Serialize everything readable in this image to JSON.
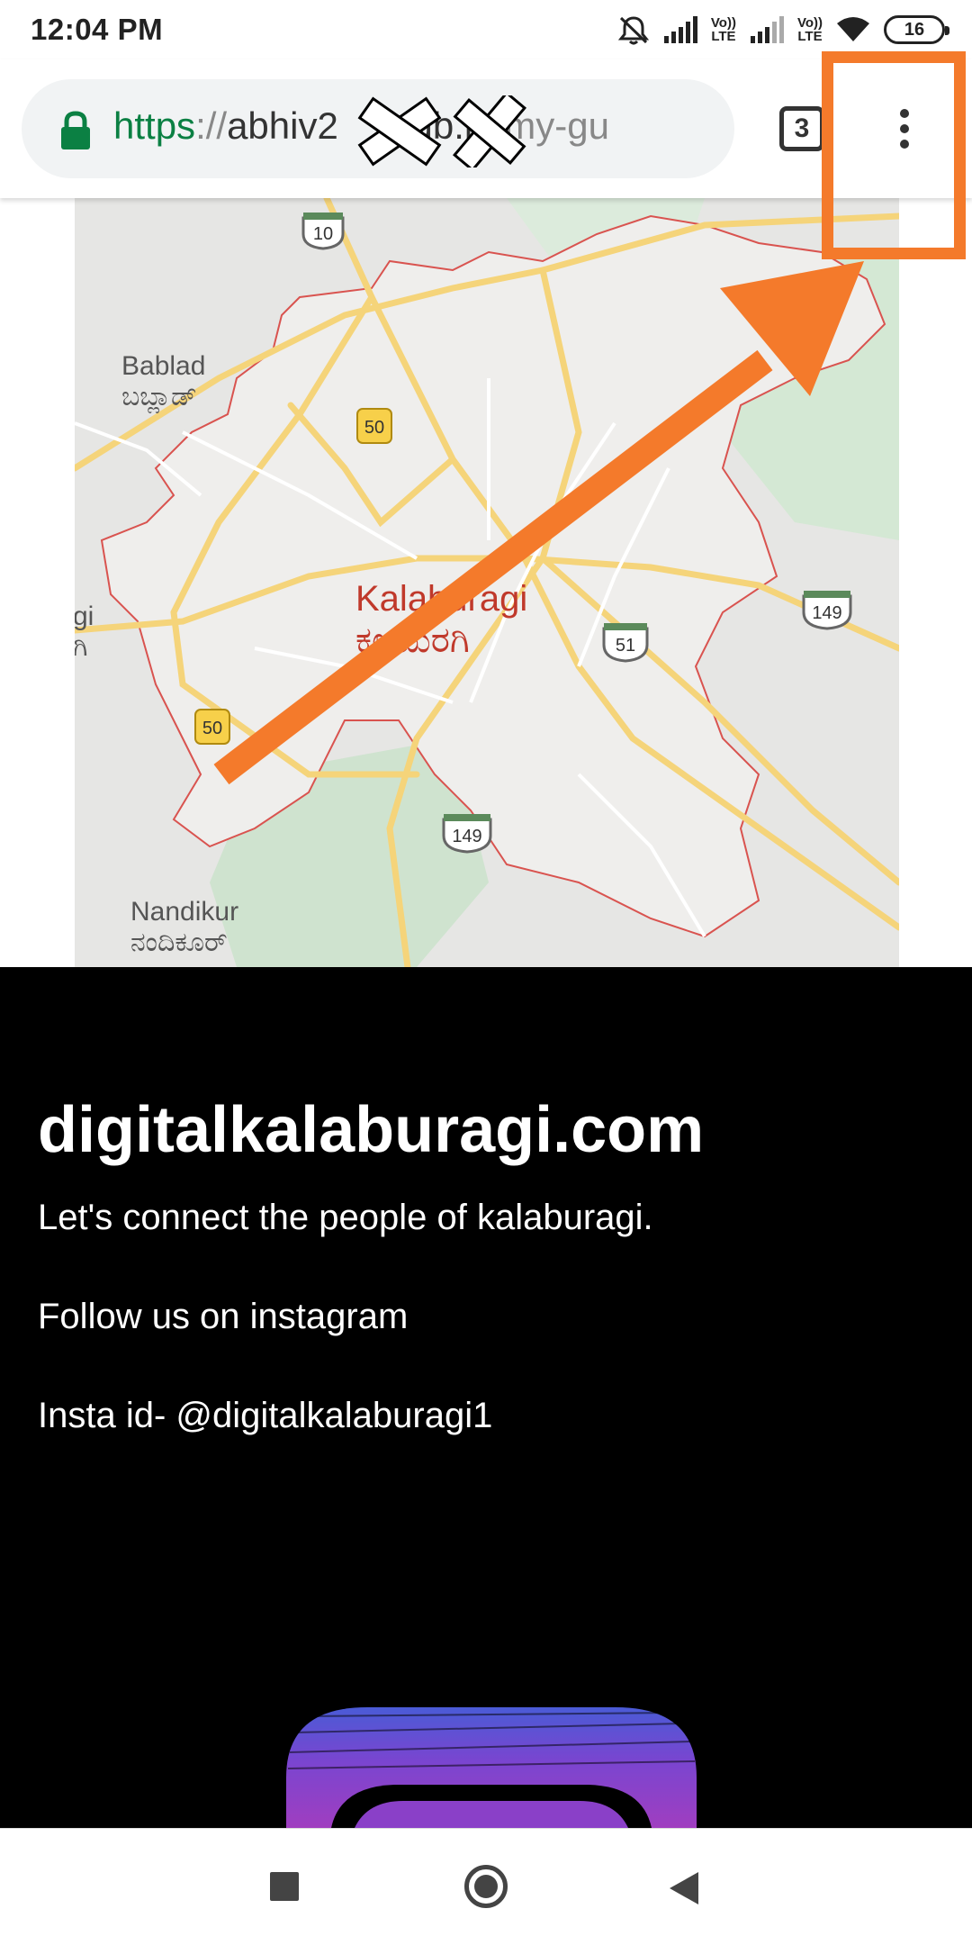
{
  "status_bar": {
    "time": "12:04 PM",
    "lte1": [
      "Vo))",
      "LTE"
    ],
    "lte2": [
      "Vo))",
      "LTE"
    ],
    "battery": "16"
  },
  "browser": {
    "url_scheme": "https",
    "url_separator": "://",
    "url_host": "abhiv2       ub.io",
    "url_path": "/my-gu",
    "tab_count": "3",
    "menu_icon": "more-vert-icon",
    "lock_icon": "lock-icon"
  },
  "map": {
    "labels": {
      "bablad": "Bablad",
      "bablad_kn": "ಬಬ್ಲಾಡ್",
      "city": "Kalaburagi",
      "city_kn": "ಕಲಬುರಗಿ",
      "nandikur": "Nandikur",
      "nandikur_kn": "ನಂದಿಕೂರ್",
      "edge_left": "gi",
      "edge_left_kn": "ಗಿ"
    },
    "shields": {
      "r10": "10",
      "r50a": "50",
      "r50b": "50",
      "r51": "51",
      "r149a": "149",
      "r149b": "149"
    }
  },
  "site": {
    "title": "digitalkalaburagi.com",
    "tagline": "Let's connect the people of kalaburagi.",
    "follow": "Follow us on instagram",
    "insta_id": "Insta id- @digitalkalaburagi1"
  },
  "colors": {
    "annotation": "#f47a2b",
    "url_scheme": "#0b8043",
    "city_label": "#c0392b"
  }
}
